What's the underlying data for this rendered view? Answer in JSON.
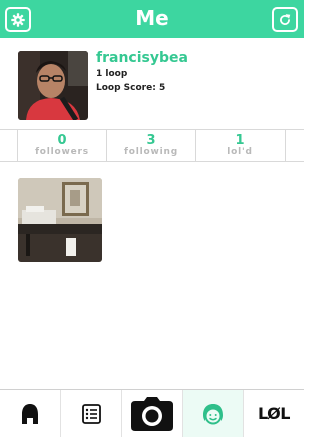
{
  "header": {
    "title": "Me",
    "left_icon": "gear-icon",
    "right_icon": "refresh-icon",
    "accent": "#3dd6a0"
  },
  "profile": {
    "username": "francisybea",
    "loops": "1 loop",
    "loop_score": "Loop Score: 5",
    "username_color": "#35c892"
  },
  "stats": [
    {
      "value": "0",
      "label": "followers"
    },
    {
      "value": "3",
      "label": "following"
    },
    {
      "value": "1",
      "label": "lol'd"
    }
  ],
  "posts": [
    {
      "icon": "video-thumbnail-icon"
    }
  ],
  "tabbar": {
    "items": [
      {
        "icon": "home-icon"
      },
      {
        "icon": "list-icon"
      },
      {
        "icon": "camera-icon"
      },
      {
        "icon": "profile-face-icon",
        "active": true
      },
      {
        "icon": "lol-icon",
        "label": "LØL"
      }
    ]
  }
}
